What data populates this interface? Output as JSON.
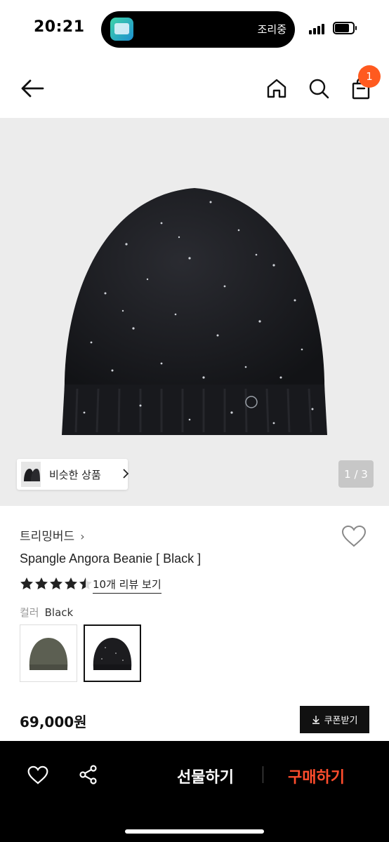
{
  "status_bar": {
    "time": "20:21",
    "island_label": "조리중"
  },
  "nav": {
    "back_icon": "arrow-left-icon",
    "home_icon": "home-icon",
    "search_icon": "search-icon",
    "cart_icon": "shopping-bag-icon",
    "cart_badge": "1"
  },
  "hero": {
    "similar_label": "비슷한 상품",
    "counter": "1 / 3"
  },
  "product": {
    "brand": "트리밍버드",
    "title": "Spangle Angora Beanie [ Black ]",
    "rating": 4.5,
    "review_link": "10개 리뷰 보기",
    "color_key": "컬러",
    "color_value": "Black",
    "swatches": [
      {
        "name": "khaki-beanie",
        "color": "#5c5f52"
      },
      {
        "name": "black-beanie",
        "color": "#1c1c1f"
      }
    ],
    "price": "69,000원",
    "coupon_label": "쿠폰받기"
  },
  "bottom_bar": {
    "gift_label": "선물하기",
    "buy_label": "구매하기",
    "buy_color": "#ff4d2d"
  },
  "colors": {
    "accent": "#ff5a1f",
    "hero_bg": "#ececec"
  }
}
